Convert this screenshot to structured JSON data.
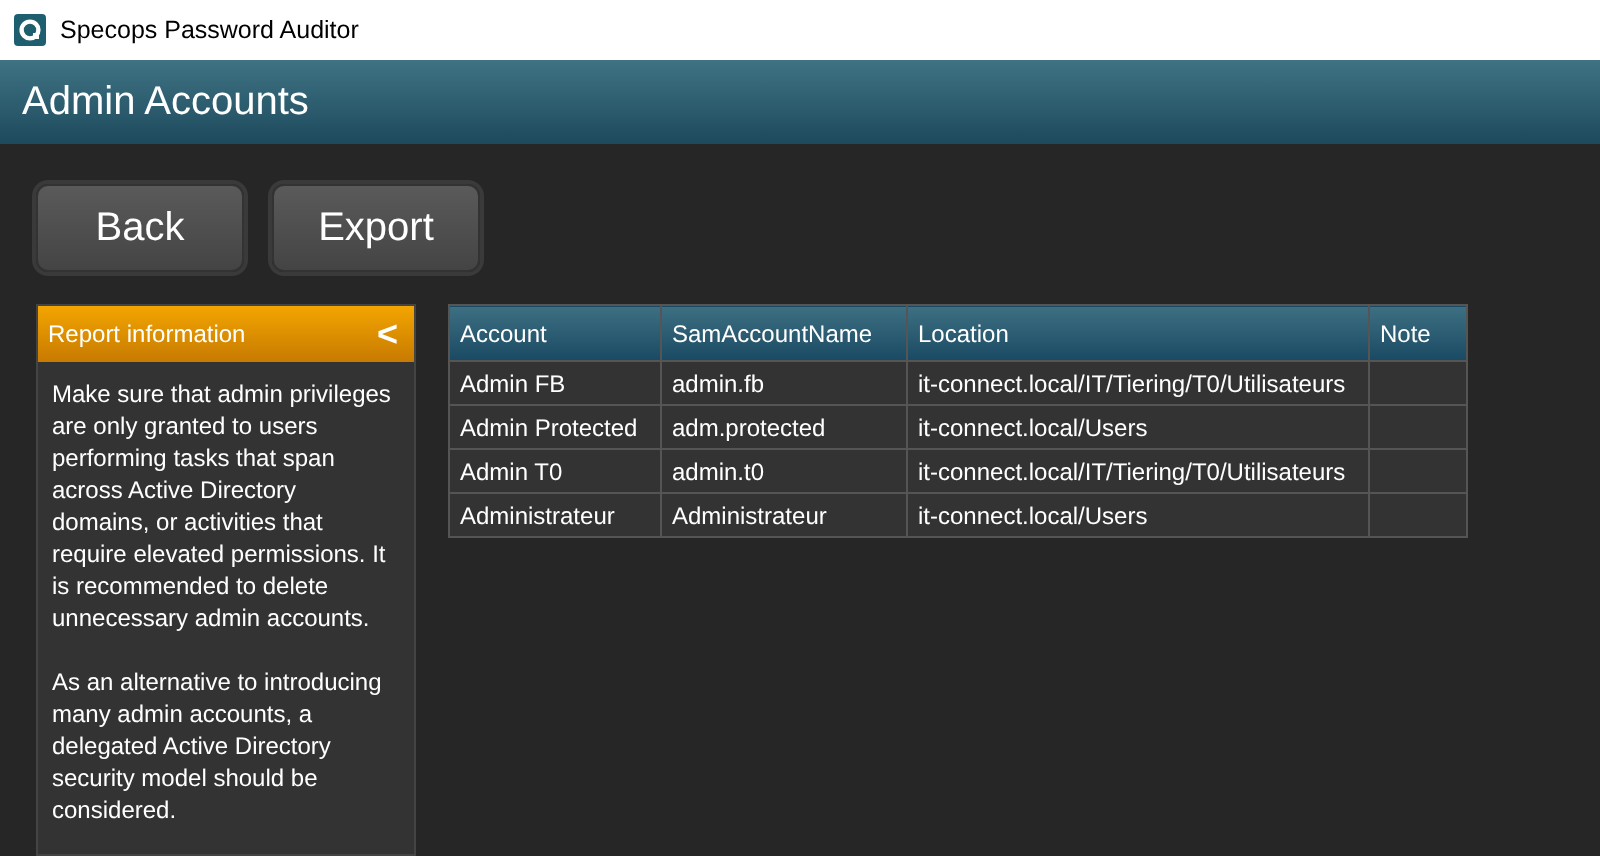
{
  "window": {
    "title": "Specops Password Auditor"
  },
  "page": {
    "title": "Admin Accounts"
  },
  "buttons": [
    "Back",
    "Export"
  ],
  "report_panel": {
    "title": "Report information",
    "collapse_glyph": "<",
    "paragraphs": [
      "Make sure that admin privileges are only granted to users performing tasks that span across Active Directory domains, or activities that require elevated permissions. It is recommended to delete unnecessary admin accounts.",
      "As an alternative to introducing many admin accounts, a delegated Active Directory security model should be considered."
    ]
  },
  "table": {
    "columns": [
      "Account",
      "SamAccountName",
      "Location",
      "Note"
    ],
    "rows": [
      [
        "Admin FB",
        "admin.fb",
        "it-connect.local/IT/Tiering/T0/Utilisateurs",
        ""
      ],
      [
        "Admin Protected",
        "adm.protected",
        "it-connect.local/Users",
        ""
      ],
      [
        "Admin T0",
        "admin.t0",
        "it-connect.local/IT/Tiering/T0/Utilisateurs",
        ""
      ],
      [
        "Administrateur",
        "Administrateur",
        "it-connect.local/Users",
        ""
      ]
    ]
  }
}
